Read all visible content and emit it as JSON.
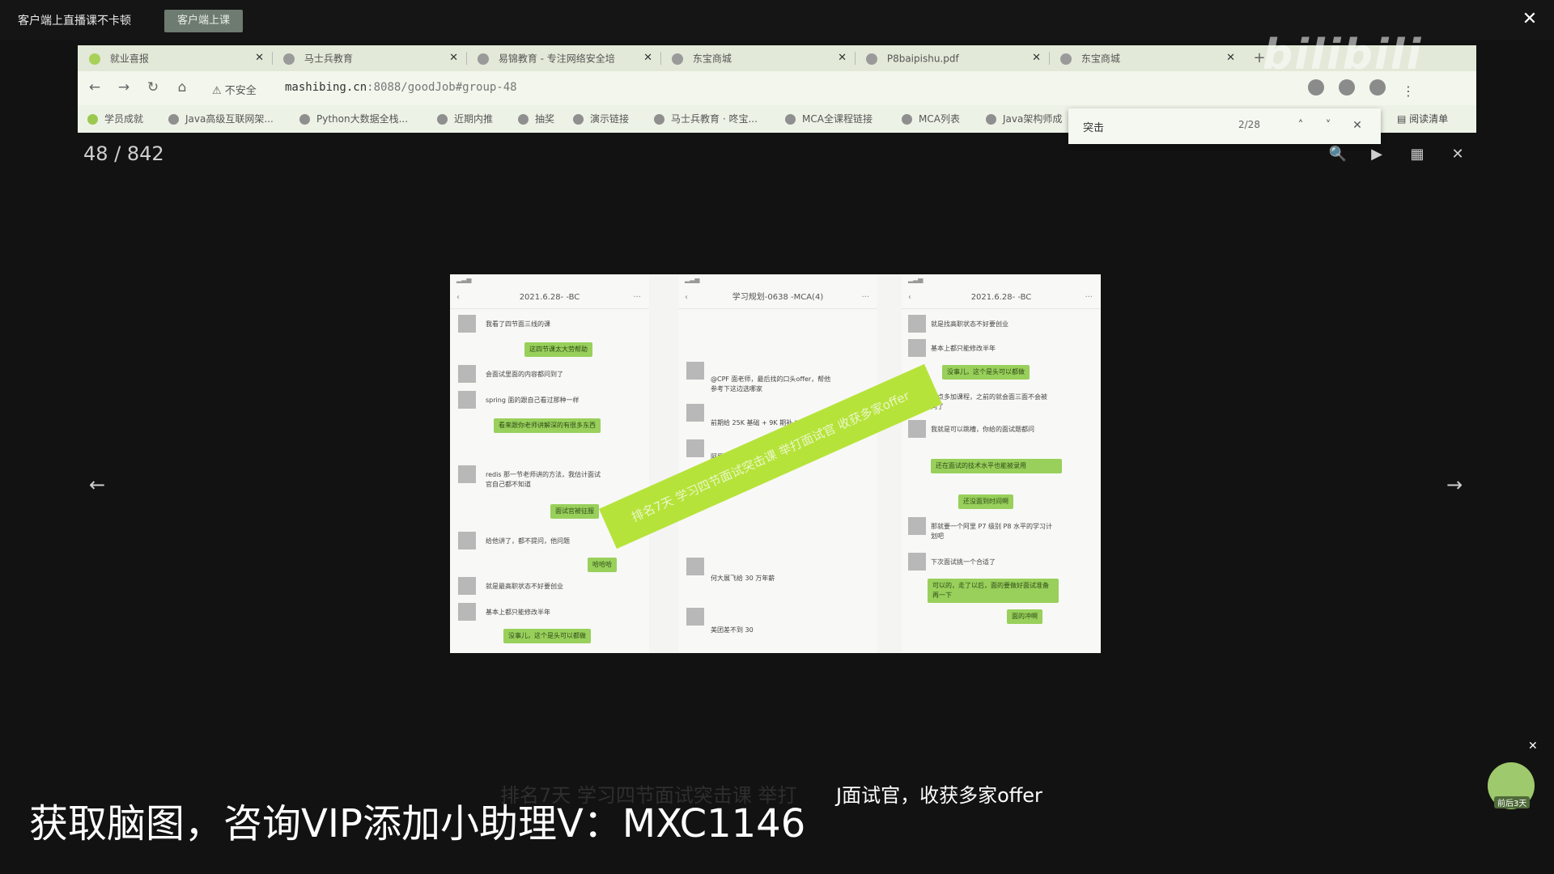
{
  "topbar": {
    "title": "客户端上直播课不卡顿",
    "client_button": "客户端上课",
    "close": "✕"
  },
  "browser": {
    "tabs": [
      {
        "label": "就业喜报",
        "close": "✕"
      },
      {
        "label": "马士兵教育",
        "close": "✕"
      },
      {
        "label": "易锦教育 - 专注网络安全培",
        "close": "✕"
      },
      {
        "label": "东宝商城",
        "close": "✕"
      },
      {
        "label": "P8baipishu.pdf",
        "close": "✕"
      },
      {
        "label": "东宝商城",
        "close": "✕"
      }
    ],
    "new_tab": "+",
    "security_warning": "不安全",
    "url_host": "mashibing.cn",
    "url_rest": ":8088/goodJob#group-48",
    "bookmarks": [
      "学员成就",
      "Java高级互联网架...",
      "Python大数据全栈...",
      "近期内推",
      "抽奖",
      "演示链接",
      "马士兵教育 · 咚宝...",
      "MCA全课程链接",
      "MCA列表",
      "Java架构师成"
    ],
    "reading_list": "阅读清单",
    "find": {
      "query": "突击",
      "count": "2/28",
      "up": "˄",
      "down": "˅",
      "close": "✕"
    }
  },
  "watermark": "bilibili",
  "viewer": {
    "counter": "48 / 842",
    "search": "🔍",
    "play": "▶",
    "grid": "▦",
    "close": "✕",
    "prev": "←",
    "next": "→"
  },
  "slide": {
    "phones": [
      {
        "header": "2021.6.28-      -BC"
      },
      {
        "header": "学习规划-0638      -MCA(4)"
      },
      {
        "header": "2021.6.28-      -BC"
      }
    ],
    "texts": {
      "p1_m1": "我看了四节面三线的课",
      "p1_b1": "这四节课太大劳帮助",
      "p1_m2": "会面试里面的内容都问到了",
      "p1_m3": "spring 面的跟自己看过那种一样",
      "p1_b2": "看来跟你老师讲解深的有很多东西",
      "p1_m4": "redis 那一节老师讲的方法，我估计面试官自己都不知道",
      "p1_b3": "面试官被征服",
      "p1_m5": "给他讲了，都不提问，他问题",
      "p1_b4": "哈哈哈",
      "p1_m6": "就是最高职状态不好要创业",
      "p1_m7": "基本上都只能修改半年",
      "p1_b5": "没事儿，这个是头可以都做",
      "p2_m1": "@CPF 面老师，最后找的口头offer，帮他参考下这边选哪家",
      "p2_m2": "前期给 25K 基础 + 9K 期补 *15",
      "p2_m3": "阿里那边给 25K",
      "p2_m4": "何大展飞给 30 万年薪",
      "p2_m5": "美团差不到 30",
      "p3_m1": "就是找高职状态不好要创业",
      "p3_m2": "基本上都只能修改半年",
      "p3_b1": "没事儿，这个是头可以都做",
      "p3_m3": "早点多加课程，之前的就会面三面不会被问了",
      "p3_m4": "我就是可以跳槽，你给的面试题都问",
      "p3_b2": "还在面试的技术水平也能被录用",
      "p3_b3": "还没面到时间啊",
      "p3_m5": "那就要一个阿里 P7 级别 P8 水平的学习计划吧",
      "p3_m6": "下次面试挑一个合适了",
      "p3_b4": "可以的，走了以后，面的要做好面试准备再一下",
      "p3_b5": "面的冲啊"
    },
    "banner": "排名7天  学习四节面试突击课  举打面试官  收获多家offer"
  },
  "subtitles": {
    "line1_faint": "排名7天  学习四节面试突击课  举打",
    "line1": "J面试官，收获多家offer",
    "line2": "获取脑图，咨询VIP添加小助理V：MXC1146"
  },
  "widget": {
    "label": "前后3天",
    "close": "✕"
  }
}
